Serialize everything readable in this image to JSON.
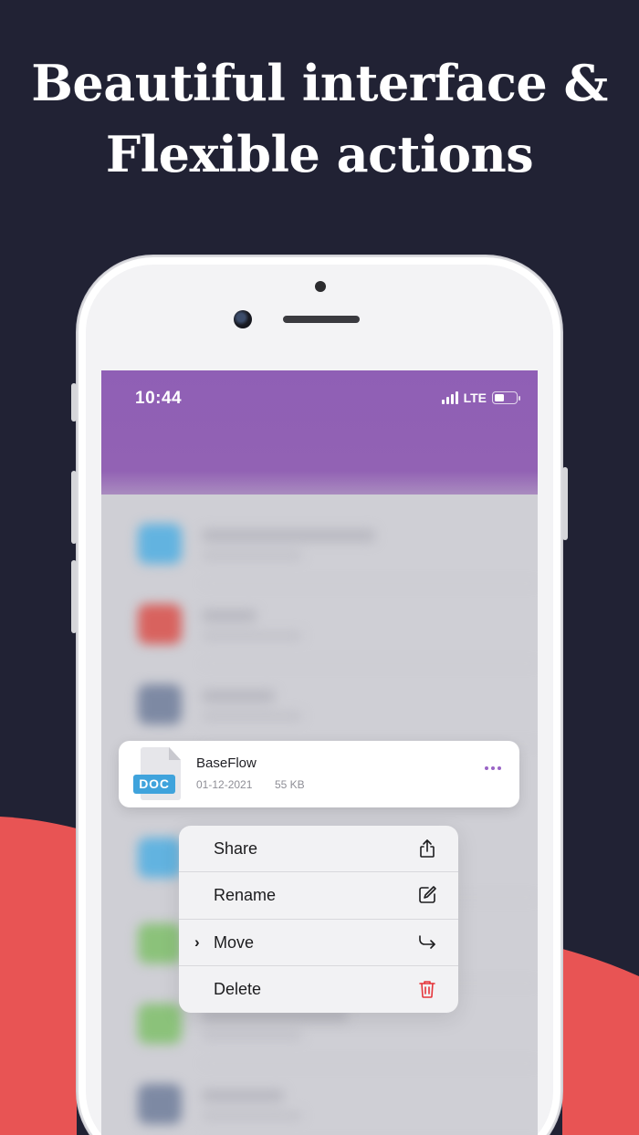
{
  "headline": {
    "line1": "Beautiful interface &",
    "line2": "Flexible actions"
  },
  "colors": {
    "background": "#212234",
    "accent_red": "#e85454",
    "app_purple": "#9262b4",
    "doc_blue": "#3fa3dc",
    "delete_red": "#e5343a"
  },
  "status_bar": {
    "time": "10:44",
    "network": "LTE"
  },
  "file_card": {
    "type_badge": "DOC",
    "name": "BaseFlow",
    "date": "01-12-2021",
    "size": "55 KB",
    "more_icon": "ellipsis-icon"
  },
  "context_menu": {
    "items": [
      {
        "label": "Share",
        "icon": "share-icon"
      },
      {
        "label": "Rename",
        "icon": "edit-icon"
      },
      {
        "label": "Move",
        "icon": "move-arrow-icon",
        "has_chevron": true
      },
      {
        "label": "Delete",
        "icon": "trash-icon",
        "destructive": true
      }
    ]
  }
}
